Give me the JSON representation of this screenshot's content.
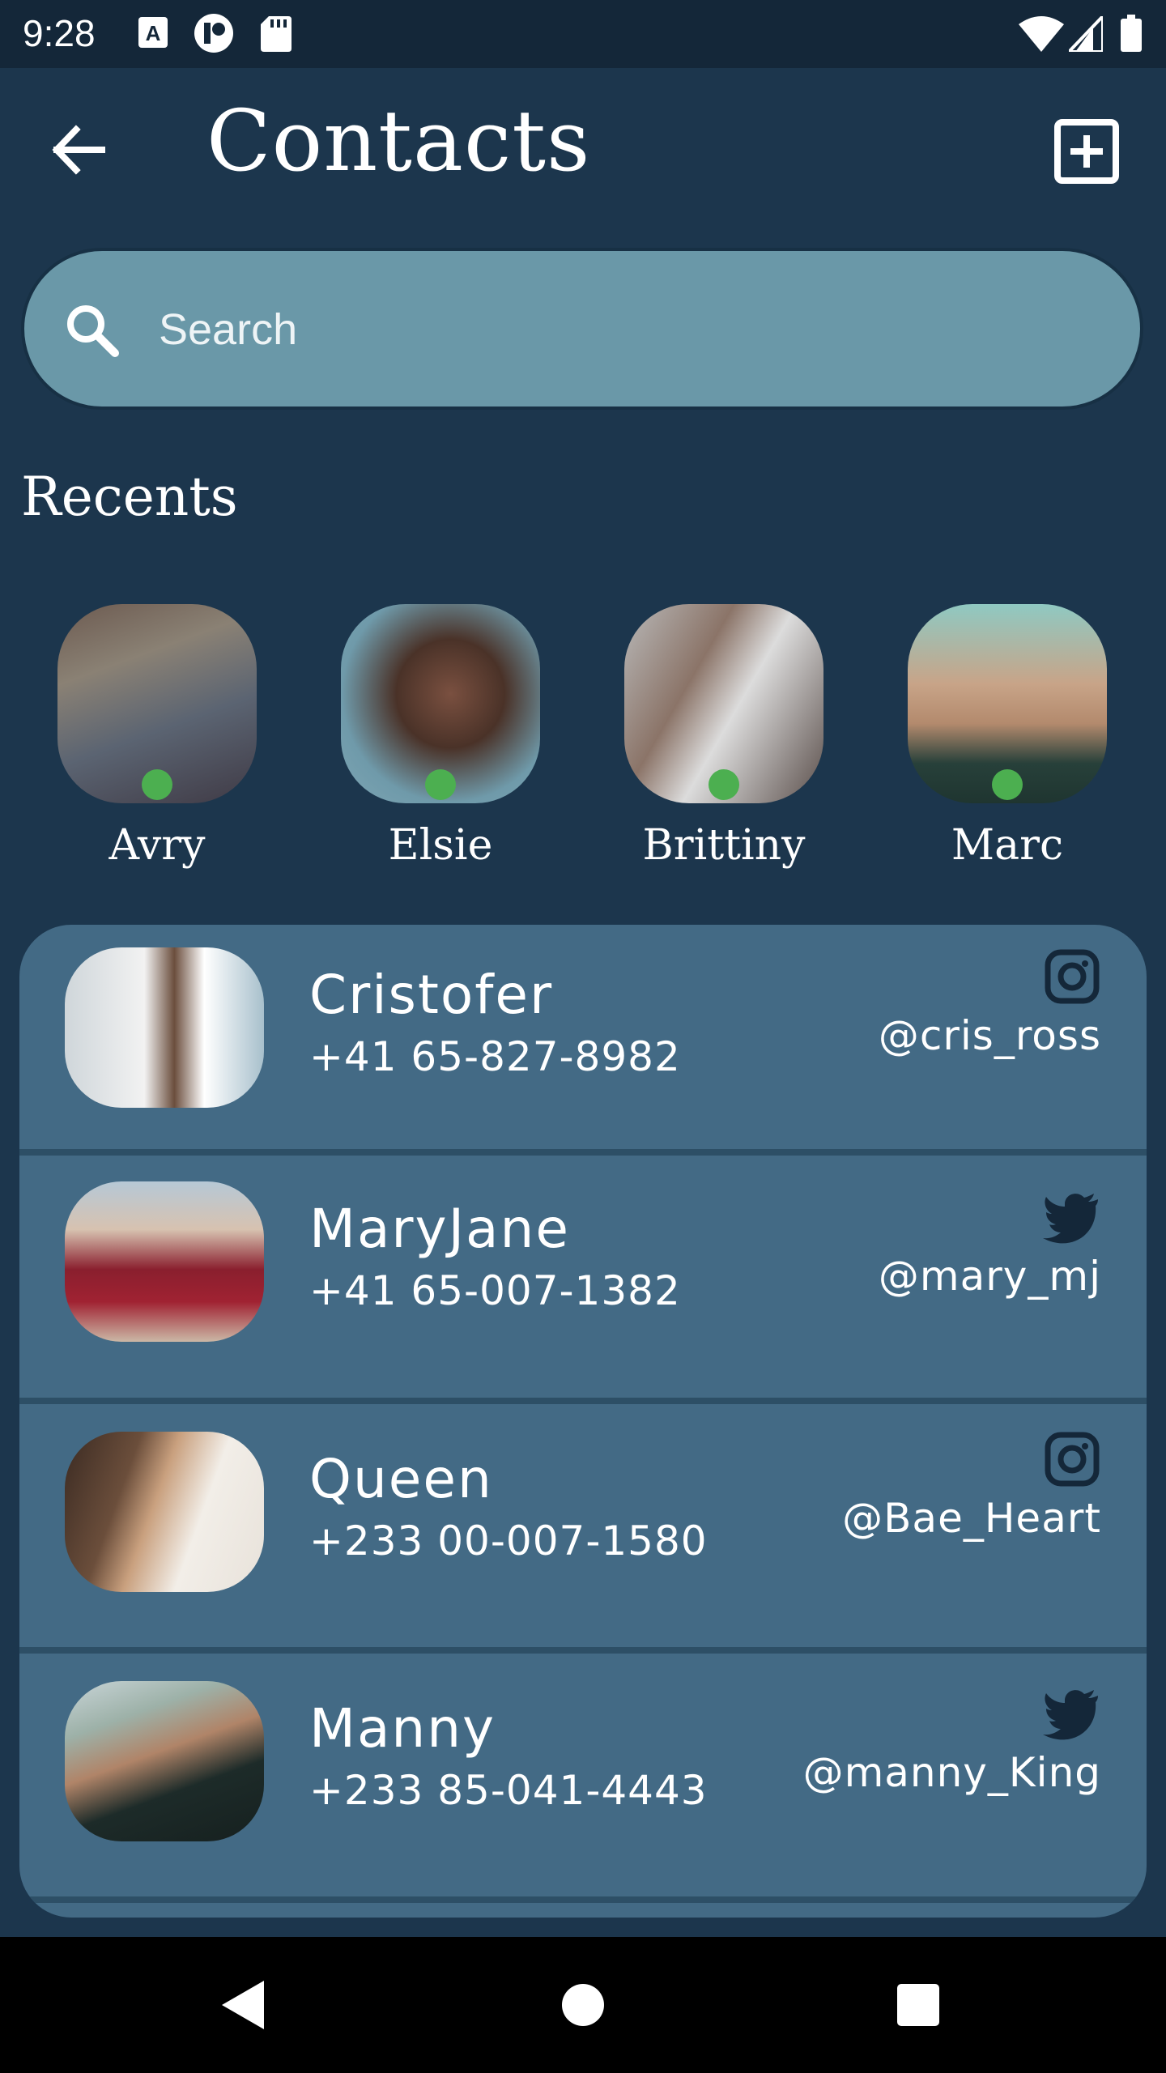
{
  "status_bar": {
    "time": "9:28",
    "icons": [
      "a-icon",
      "vpn-icon",
      "sd-card-icon",
      "wifi-icon",
      "signal-icon",
      "battery-icon"
    ]
  },
  "header": {
    "title": "Contacts",
    "back_icon": "arrow-back-icon",
    "add_icon": "add-box-icon"
  },
  "search": {
    "placeholder": "Search",
    "value": "",
    "icon": "search-icon"
  },
  "recents": {
    "title": "Recents",
    "items": [
      {
        "name": "Avry",
        "online": true
      },
      {
        "name": "Elsie",
        "online": true
      },
      {
        "name": "Brittiny",
        "online": true
      },
      {
        "name": "Marc",
        "online": true
      }
    ]
  },
  "contacts": [
    {
      "name": "Cristofer",
      "phone": "+41 65-827-8982",
      "social": "instagram-icon",
      "handle": "@cris_ross"
    },
    {
      "name": "MaryJane",
      "phone": "+41 65-007-1382",
      "social": "twitter-icon",
      "handle": "@mary_mj"
    },
    {
      "name": "Queen",
      "phone": "+233 00-007-1580",
      "social": "instagram-icon",
      "handle": "@Bae_Heart"
    },
    {
      "name": "Manny",
      "phone": "+233 85-041-4443",
      "social": "twitter-icon",
      "handle": "@manny_King"
    }
  ],
  "nav_bar": {
    "buttons": [
      "back-triangle-icon",
      "home-circle-icon",
      "recents-square-icon"
    ]
  },
  "colors": {
    "background": "#1c364d",
    "search_fill": "#6a98a8",
    "list_fill": "#436a85",
    "online": "#4caf50"
  }
}
